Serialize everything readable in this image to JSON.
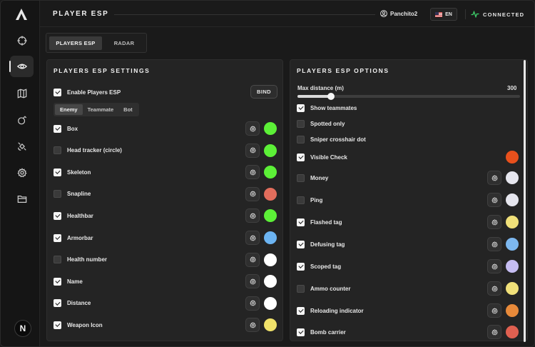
{
  "header": {
    "title": "PLAYER ESP",
    "username": "Panchito2",
    "language": "EN",
    "status": "CONNECTED",
    "status_color": "#3ecf6a"
  },
  "sidebar": {
    "items": [
      {
        "icon": "crosshair-icon",
        "active": false
      },
      {
        "icon": "eye-icon",
        "active": true
      },
      {
        "icon": "map-icon",
        "active": false
      },
      {
        "icon": "grenade-icon",
        "active": false
      },
      {
        "icon": "satellite-icon",
        "active": false
      },
      {
        "icon": "gear-icon",
        "active": false
      },
      {
        "icon": "folder-icon",
        "active": false
      }
    ],
    "bottom_logo": "N"
  },
  "tabs": [
    {
      "label": "PLAYERS ESP",
      "active": true
    },
    {
      "label": "RADAR",
      "active": false
    }
  ],
  "left_panel": {
    "title": "PLAYERS ESP SETTINGS",
    "enable_label": "Enable Players ESP",
    "enable_checked": true,
    "bind_label": "BIND",
    "segments": [
      {
        "label": "Enemy",
        "active": true
      },
      {
        "label": "Teammate",
        "active": false
      },
      {
        "label": "Bot",
        "active": false
      }
    ],
    "items": [
      {
        "label": "Box",
        "checked": true,
        "color": "#5cf037"
      },
      {
        "label": "Head tracker (circle)",
        "checked": false,
        "color": "#5cf037"
      },
      {
        "label": "Skeleton",
        "checked": true,
        "color": "#5cf037"
      },
      {
        "label": "Snapline",
        "checked": false,
        "color": "#e26d5c"
      },
      {
        "label": "Healthbar",
        "checked": true,
        "color": "#5cf037"
      },
      {
        "label": "Armorbar",
        "checked": true,
        "color": "#6cb4f2"
      },
      {
        "label": "Health number",
        "checked": false,
        "color": "#ffffff"
      },
      {
        "label": "Name",
        "checked": true,
        "color": "#ffffff"
      },
      {
        "label": "Distance",
        "checked": true,
        "color": "#ffffff"
      },
      {
        "label": "Weapon Icon",
        "checked": true,
        "color": "#f0e26a"
      }
    ]
  },
  "right_panel": {
    "title": "PLAYERS ESP OPTIONS",
    "slider": {
      "label": "Max distance (m)",
      "value": "300",
      "fraction": 0.15
    },
    "items": [
      {
        "label": "Show teammates",
        "checked": true,
        "gear": false,
        "color": null
      },
      {
        "label": "Spotted only",
        "checked": false,
        "gear": false,
        "color": null
      },
      {
        "label": "Sniper crosshair dot",
        "checked": false,
        "gear": false,
        "color": null
      },
      {
        "label": "Visible Check",
        "checked": true,
        "gear": false,
        "color": "#e8501c"
      },
      {
        "label": "Money",
        "checked": false,
        "gear": true,
        "color": "#e6e6ee"
      },
      {
        "label": "Ping",
        "checked": false,
        "gear": true,
        "color": "#e6e6ee"
      },
      {
        "label": "Flashed tag",
        "checked": true,
        "gear": true,
        "color": "#f0e079"
      },
      {
        "label": "Defusing tag",
        "checked": true,
        "gear": true,
        "color": "#7db8f0"
      },
      {
        "label": "Scoped tag",
        "checked": true,
        "gear": true,
        "color": "#c6bdf2"
      },
      {
        "label": "Ammo counter",
        "checked": false,
        "gear": true,
        "color": "#f0e079"
      },
      {
        "label": "Reloading indicator",
        "checked": true,
        "gear": true,
        "color": "#e88a3a"
      },
      {
        "label": "Bomb carrier",
        "checked": true,
        "gear": true,
        "color": "#e06050"
      }
    ]
  }
}
